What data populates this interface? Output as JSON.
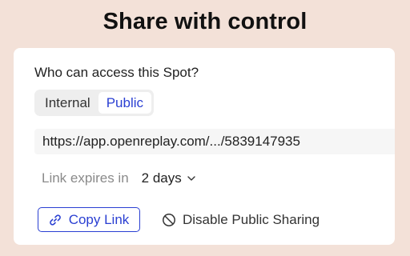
{
  "headline": "Share with control",
  "card": {
    "question": "Who can access this Spot?",
    "access_tabs": [
      {
        "label": "Internal",
        "selected": false
      },
      {
        "label": "Public",
        "selected": true
      }
    ],
    "share_url": "https://app.openreplay.com/.../5839147935",
    "expiry": {
      "label": "Link expires in",
      "value": "2 days"
    },
    "actions": {
      "copy_label": "Copy Link",
      "disable_label": "Disable Public Sharing"
    }
  },
  "colors": {
    "background": "#f3e1d8",
    "accent": "#2a3fd2",
    "card": "#ffffff"
  },
  "icons": {
    "copy": "link-icon",
    "disable": "block-icon",
    "expiry": "chevron-down-icon"
  }
}
